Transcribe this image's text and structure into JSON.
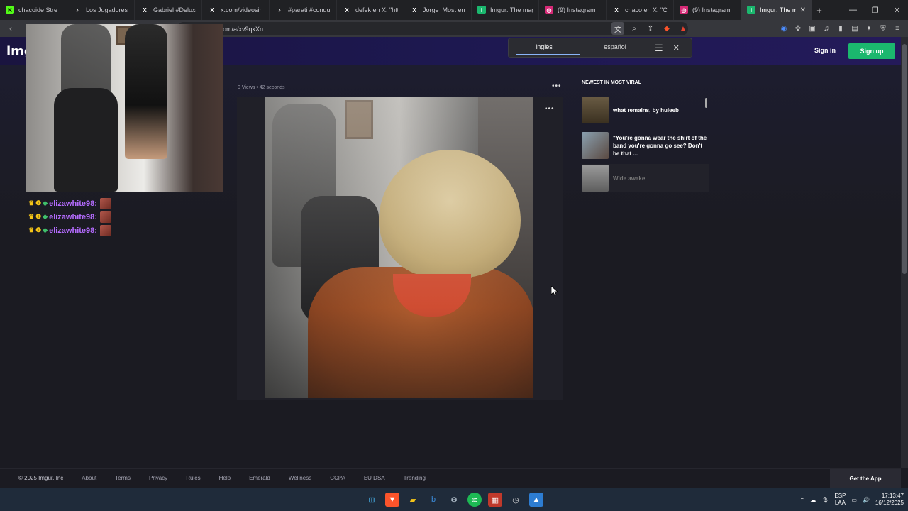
{
  "browser": {
    "tabs": [
      {
        "label": "chacoide Stre",
        "icon": "kick-icon",
        "color": "#53fc18"
      },
      {
        "label": "Los Jugadores M",
        "icon": "tiktok-icon",
        "color": "#111111"
      },
      {
        "label": "Gabriel #DeluxeA",
        "icon": "x-icon",
        "color": "#111111"
      },
      {
        "label": "x.com/videosinfo",
        "icon": "x-icon",
        "color": "#111111"
      },
      {
        "label": "#parati #condu",
        "icon": "tiktok-icon",
        "color": "#111111"
      },
      {
        "label": "defek en X: \"http",
        "icon": "x-icon",
        "color": "#111111"
      },
      {
        "label": "Jorge_Most en X",
        "icon": "x-icon",
        "color": "#111111"
      },
      {
        "label": "Imgur: The magi",
        "icon": "imgur-icon",
        "color": "#1bb76e"
      },
      {
        "label": "(9) Instagram",
        "icon": "instagram-icon",
        "color": "#d62976"
      },
      {
        "label": "chaco en X: \"Cuid",
        "icon": "x-icon",
        "color": "#111111"
      },
      {
        "label": "(9) Instagram",
        "icon": "instagram-icon",
        "color": "#d62976"
      },
      {
        "label": "Imgur: The m",
        "icon": "imgur-icon",
        "color": "#1bb76e"
      }
    ],
    "url": "om/a/xv9qkXn"
  },
  "translate_popup": {
    "source_lang": "inglés",
    "target_lang": "español"
  },
  "imgur": {
    "logo": "img",
    "sign_in": "Sign in",
    "sign_up": "Sign up",
    "post_meta": "0 Views • 42 seconds",
    "sidebar": {
      "heading": "NEWEST IN MOST VIRAL",
      "items": [
        {
          "title": "what remains, by huleeb"
        },
        {
          "title": "\"You're gonna wear the shirt of the band you're gonna go see? Don't be that ..."
        },
        {
          "title": "Wide awake"
        }
      ]
    },
    "footer": {
      "copyright": "© 2025 Imgur, Inc",
      "links": [
        "About",
        "Terms",
        "Privacy",
        "Rules",
        "Help",
        "Emerald",
        "Wellness",
        "CCPA",
        "EU DSA",
        "Trending"
      ],
      "get_app": "Get the App"
    }
  },
  "chat": {
    "messages": [
      {
        "user": "elizawhite98:"
      },
      {
        "user": "elizawhite98:"
      },
      {
        "user": "elizawhite98:"
      }
    ]
  },
  "taskbar": {
    "lang_line1": "ESP",
    "lang_line2": "LAA",
    "time": "17:13:47",
    "date": "16/12/2025"
  },
  "colors": {
    "accent_green": "#1bb76e",
    "chat_user": "#b56cff"
  }
}
